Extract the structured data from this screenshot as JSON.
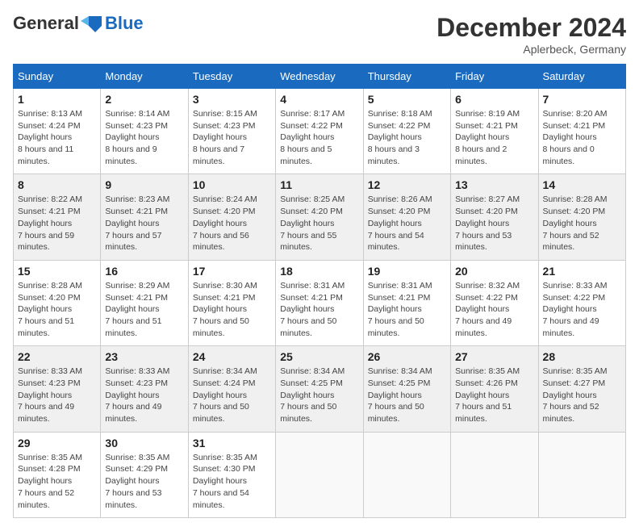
{
  "header": {
    "logo_general": "General",
    "logo_blue": "Blue",
    "month_title": "December 2024",
    "location": "Aplerbeck, Germany"
  },
  "weekdays": [
    "Sunday",
    "Monday",
    "Tuesday",
    "Wednesday",
    "Thursday",
    "Friday",
    "Saturday"
  ],
  "weeks": [
    [
      {
        "day": 1,
        "sunrise": "8:13 AM",
        "sunset": "4:24 PM",
        "daylight": "8 hours and 11 minutes."
      },
      {
        "day": 2,
        "sunrise": "8:14 AM",
        "sunset": "4:23 PM",
        "daylight": "8 hours and 9 minutes."
      },
      {
        "day": 3,
        "sunrise": "8:15 AM",
        "sunset": "4:23 PM",
        "daylight": "8 hours and 7 minutes."
      },
      {
        "day": 4,
        "sunrise": "8:17 AM",
        "sunset": "4:22 PM",
        "daylight": "8 hours and 5 minutes."
      },
      {
        "day": 5,
        "sunrise": "8:18 AM",
        "sunset": "4:22 PM",
        "daylight": "8 hours and 3 minutes."
      },
      {
        "day": 6,
        "sunrise": "8:19 AM",
        "sunset": "4:21 PM",
        "daylight": "8 hours and 2 minutes."
      },
      {
        "day": 7,
        "sunrise": "8:20 AM",
        "sunset": "4:21 PM",
        "daylight": "8 hours and 0 minutes."
      }
    ],
    [
      {
        "day": 8,
        "sunrise": "8:22 AM",
        "sunset": "4:21 PM",
        "daylight": "7 hours and 59 minutes."
      },
      {
        "day": 9,
        "sunrise": "8:23 AM",
        "sunset": "4:21 PM",
        "daylight": "7 hours and 57 minutes."
      },
      {
        "day": 10,
        "sunrise": "8:24 AM",
        "sunset": "4:20 PM",
        "daylight": "7 hours and 56 minutes."
      },
      {
        "day": 11,
        "sunrise": "8:25 AM",
        "sunset": "4:20 PM",
        "daylight": "7 hours and 55 minutes."
      },
      {
        "day": 12,
        "sunrise": "8:26 AM",
        "sunset": "4:20 PM",
        "daylight": "7 hours and 54 minutes."
      },
      {
        "day": 13,
        "sunrise": "8:27 AM",
        "sunset": "4:20 PM",
        "daylight": "7 hours and 53 minutes."
      },
      {
        "day": 14,
        "sunrise": "8:28 AM",
        "sunset": "4:20 PM",
        "daylight": "7 hours and 52 minutes."
      }
    ],
    [
      {
        "day": 15,
        "sunrise": "8:28 AM",
        "sunset": "4:20 PM",
        "daylight": "7 hours and 51 minutes."
      },
      {
        "day": 16,
        "sunrise": "8:29 AM",
        "sunset": "4:21 PM",
        "daylight": "7 hours and 51 minutes."
      },
      {
        "day": 17,
        "sunrise": "8:30 AM",
        "sunset": "4:21 PM",
        "daylight": "7 hours and 50 minutes."
      },
      {
        "day": 18,
        "sunrise": "8:31 AM",
        "sunset": "4:21 PM",
        "daylight": "7 hours and 50 minutes."
      },
      {
        "day": 19,
        "sunrise": "8:31 AM",
        "sunset": "4:21 PM",
        "daylight": "7 hours and 50 minutes."
      },
      {
        "day": 20,
        "sunrise": "8:32 AM",
        "sunset": "4:22 PM",
        "daylight": "7 hours and 49 minutes."
      },
      {
        "day": 21,
        "sunrise": "8:33 AM",
        "sunset": "4:22 PM",
        "daylight": "7 hours and 49 minutes."
      }
    ],
    [
      {
        "day": 22,
        "sunrise": "8:33 AM",
        "sunset": "4:23 PM",
        "daylight": "7 hours and 49 minutes."
      },
      {
        "day": 23,
        "sunrise": "8:33 AM",
        "sunset": "4:23 PM",
        "daylight": "7 hours and 49 minutes."
      },
      {
        "day": 24,
        "sunrise": "8:34 AM",
        "sunset": "4:24 PM",
        "daylight": "7 hours and 50 minutes."
      },
      {
        "day": 25,
        "sunrise": "8:34 AM",
        "sunset": "4:25 PM",
        "daylight": "7 hours and 50 minutes."
      },
      {
        "day": 26,
        "sunrise": "8:34 AM",
        "sunset": "4:25 PM",
        "daylight": "7 hours and 50 minutes."
      },
      {
        "day": 27,
        "sunrise": "8:35 AM",
        "sunset": "4:26 PM",
        "daylight": "7 hours and 51 minutes."
      },
      {
        "day": 28,
        "sunrise": "8:35 AM",
        "sunset": "4:27 PM",
        "daylight": "7 hours and 52 minutes."
      }
    ],
    [
      {
        "day": 29,
        "sunrise": "8:35 AM",
        "sunset": "4:28 PM",
        "daylight": "7 hours and 52 minutes."
      },
      {
        "day": 30,
        "sunrise": "8:35 AM",
        "sunset": "4:29 PM",
        "daylight": "7 hours and 53 minutes."
      },
      {
        "day": 31,
        "sunrise": "8:35 AM",
        "sunset": "4:30 PM",
        "daylight": "7 hours and 54 minutes."
      },
      null,
      null,
      null,
      null
    ]
  ]
}
